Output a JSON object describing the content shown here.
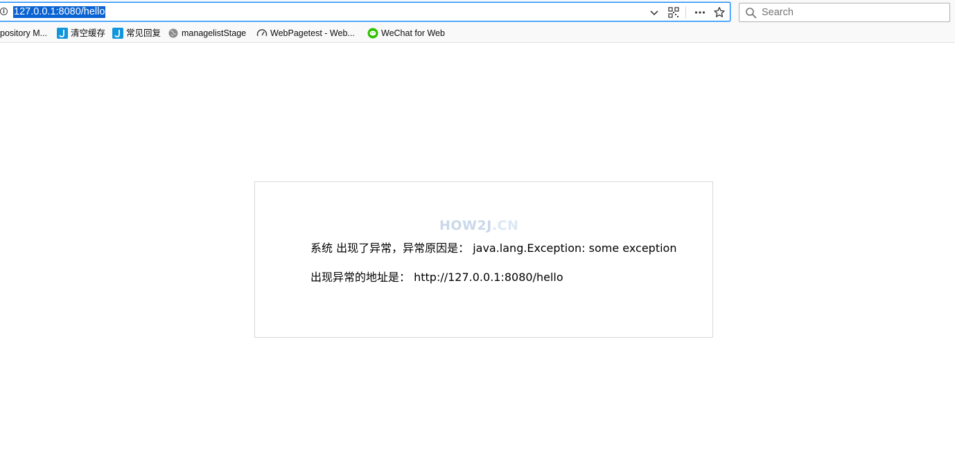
{
  "browser": {
    "url": "127.0.0.1:8080/hello",
    "search_placeholder": "Search"
  },
  "bookmarks": [
    {
      "label": "pository M...",
      "icon": "repository-icon"
    },
    {
      "label": "清空缓存",
      "icon": "j-bookmark-icon"
    },
    {
      "label": "常见回复",
      "icon": "j-bookmark-icon"
    },
    {
      "label": "managelistStage",
      "icon": "globe-icon"
    },
    {
      "label": "WebPagetest - Web...",
      "icon": "speedometer-icon"
    },
    {
      "label": "WeChat for Web",
      "icon": "wechat-icon"
    }
  ],
  "colors": {
    "accent": "#0a84ff",
    "selection": "#0a63d2",
    "j_icon": "#1296db",
    "wechat": "#2dc100"
  },
  "page": {
    "watermark_main": "HOW2J",
    "watermark_suffix": ".CN",
    "error_label": "系统 出现了异常，异常原因是：",
    "error_value": "java.lang.Exception: some exception",
    "url_label": "出现异常的地址是：",
    "url_value": "http://127.0.0.1:8080/hello"
  }
}
